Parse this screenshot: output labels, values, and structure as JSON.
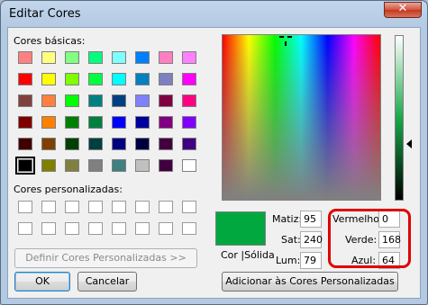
{
  "window": {
    "title": "Editar Cores",
    "close_glyph": "✕"
  },
  "basic_colors": {
    "label": "Cores básicas:",
    "swatches": [
      [
        "#ff8080",
        "#ffff80",
        "#80ff80",
        "#00ff80",
        "#80ffff",
        "#0080ff",
        "#ff80c0",
        "#ff80ff"
      ],
      [
        "#ff0000",
        "#ffff00",
        "#80ff00",
        "#00ff40",
        "#00ffff",
        "#0080c0",
        "#8080c0",
        "#ff00ff"
      ],
      [
        "#804040",
        "#ff8040",
        "#00ff00",
        "#008080",
        "#004080",
        "#8080ff",
        "#800040",
        "#ff0080"
      ],
      [
        "#800000",
        "#ff8000",
        "#008000",
        "#008040",
        "#0000ff",
        "#0000a0",
        "#800080",
        "#8000ff"
      ],
      [
        "#400000",
        "#804000",
        "#004000",
        "#004040",
        "#000080",
        "#000040",
        "#400040",
        "#400080"
      ],
      [
        "#000000",
        "#808000",
        "#808040",
        "#808080",
        "#408080",
        "#c0c0c0",
        "#400040",
        "#ffffff"
      ]
    ],
    "selected_index": 40
  },
  "custom_colors": {
    "label": "Cores personalizadas:",
    "count": 16
  },
  "buttons": {
    "define_custom": "Definir Cores Personalizadas >>",
    "ok": "OK",
    "cancel": "Cancelar",
    "add_custom": "Adicionar às Cores Personalizadas"
  },
  "preview": {
    "label": "Cor |Sólida",
    "color": "#01a840"
  },
  "hsl": {
    "hue": {
      "label": "Matiz:",
      "value": "95"
    },
    "sat": {
      "label": "Sat:",
      "value": "240"
    },
    "lum": {
      "label": "Lum:",
      "value": "79"
    }
  },
  "rgb": {
    "red": {
      "label": "Vermelho:",
      "value": "0"
    },
    "green": {
      "label": "Verde:",
      "value": "168"
    },
    "blue": {
      "label": "Azul:",
      "value": "64"
    }
  },
  "colors": {
    "highlight": "#e00000",
    "close_button": "#c2381f"
  }
}
